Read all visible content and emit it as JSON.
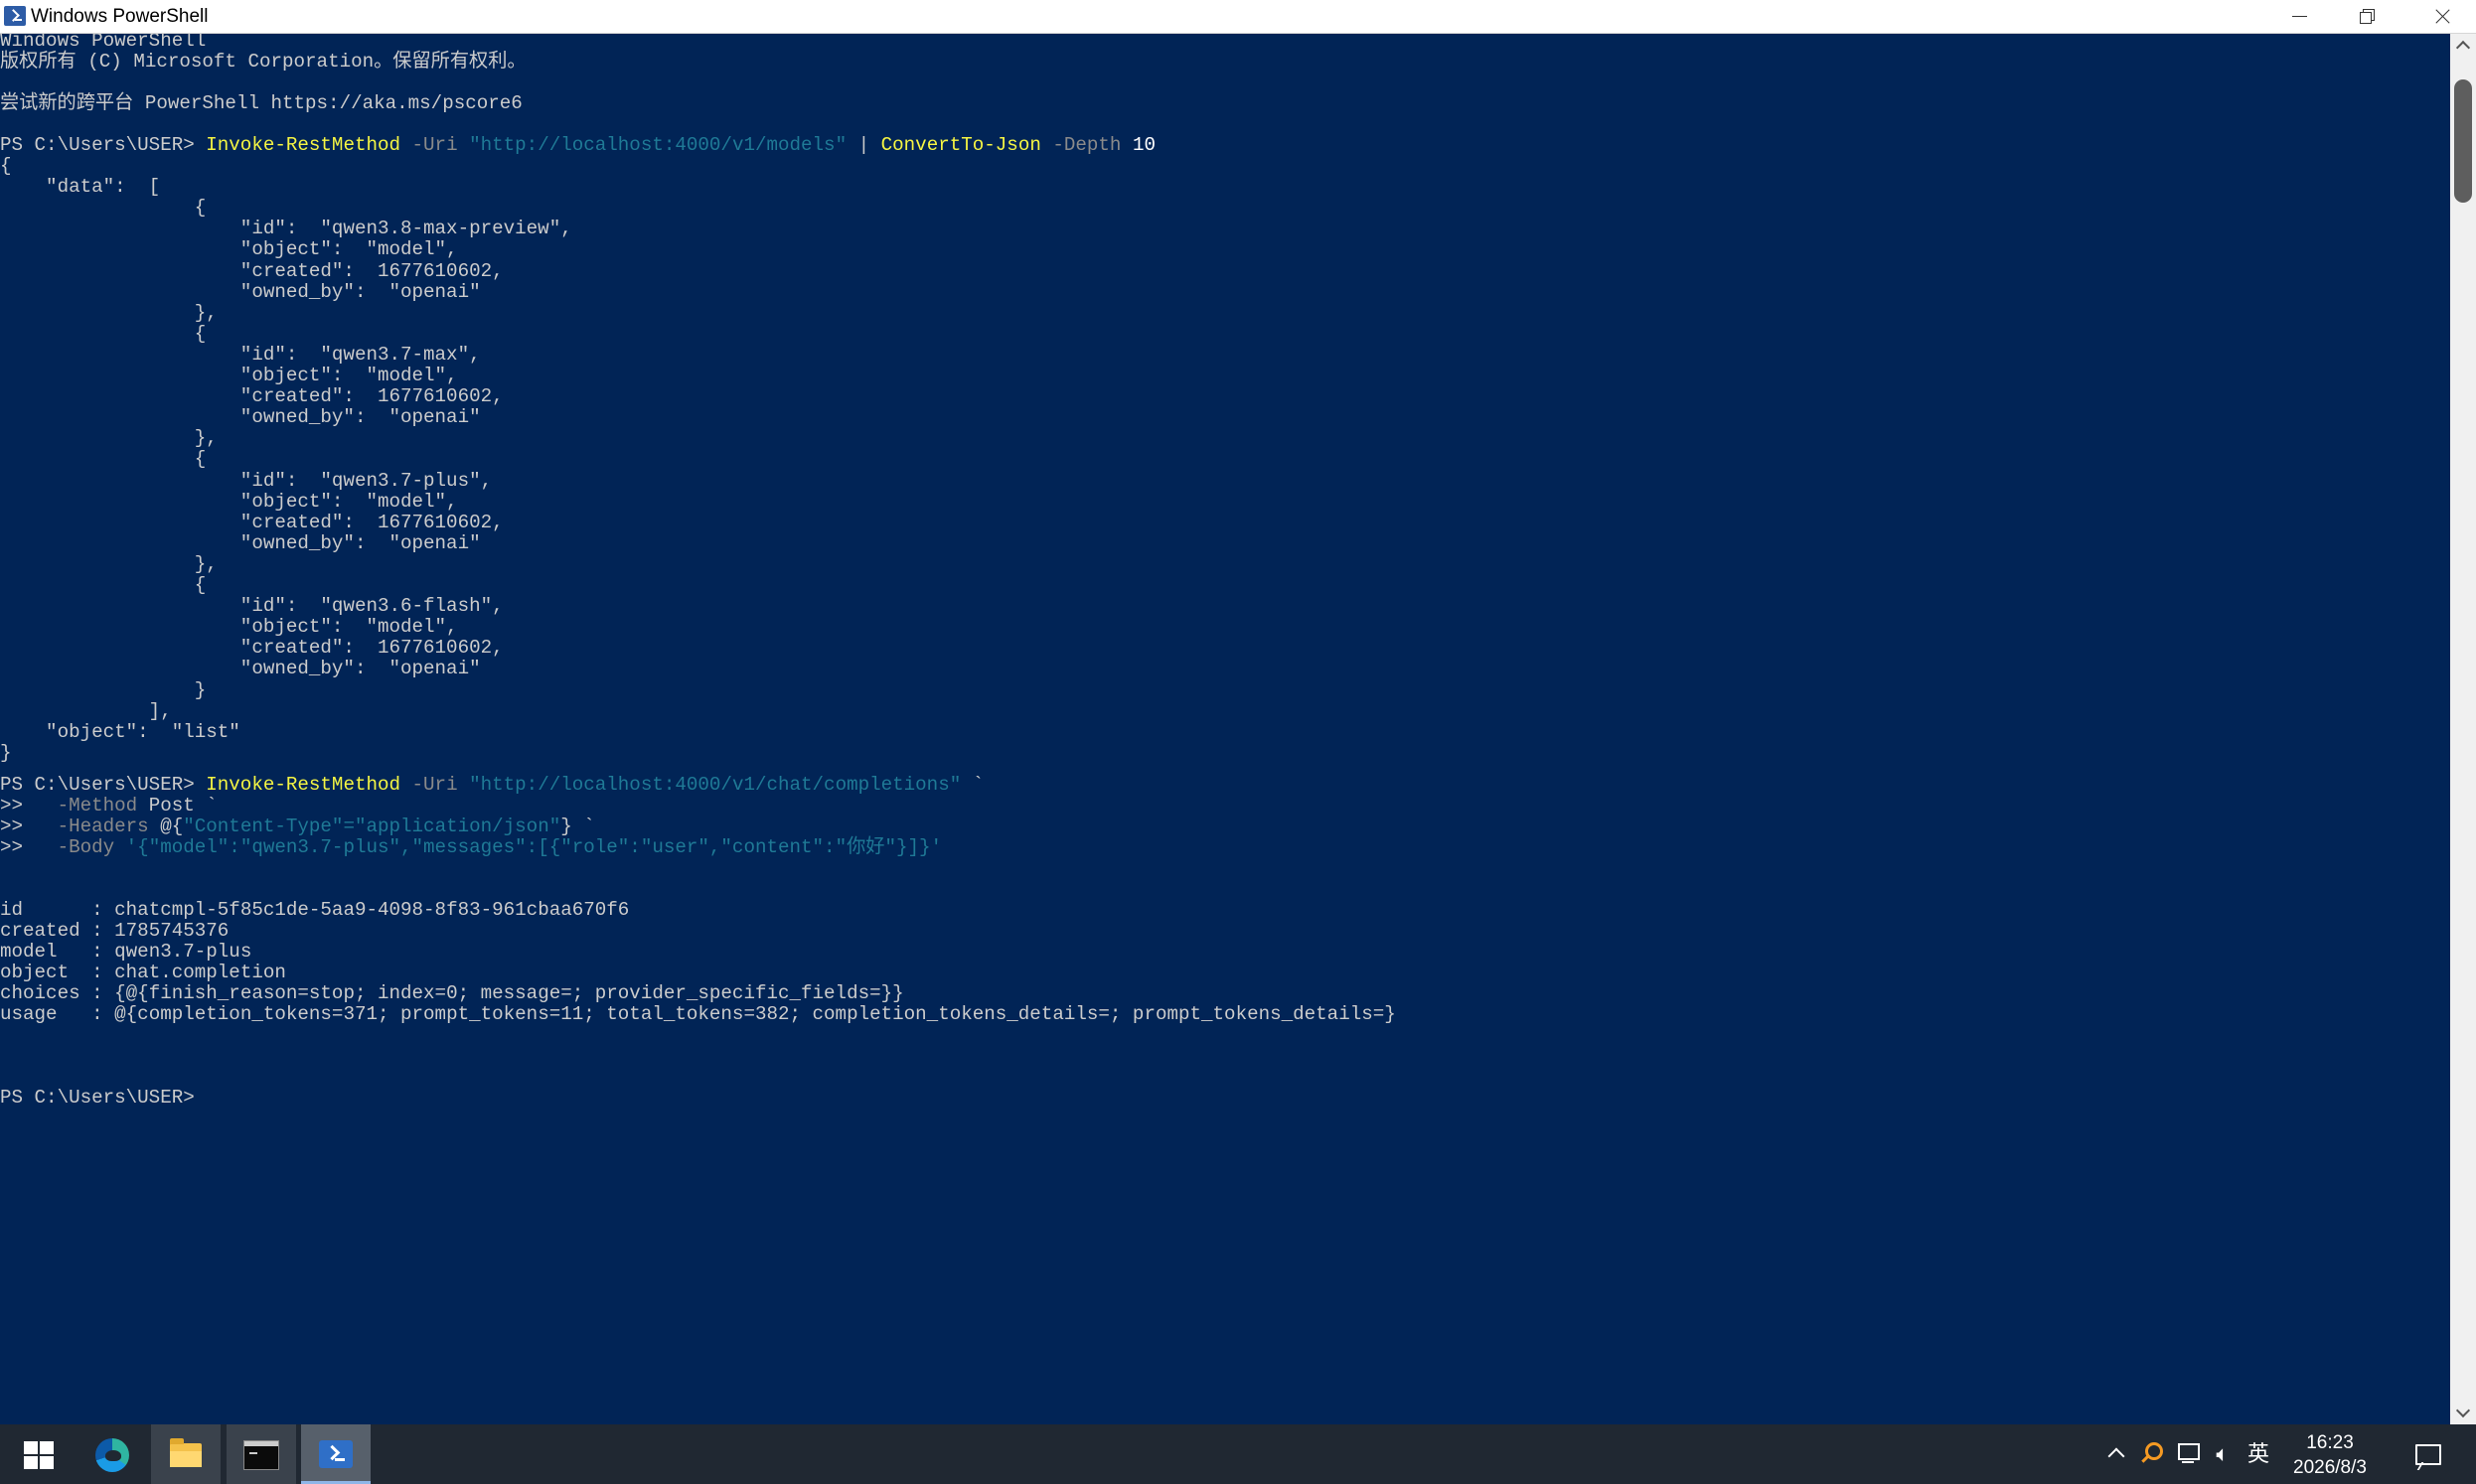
{
  "window": {
    "title": "Windows PowerShell"
  },
  "console": {
    "banner": {
      "line1": "Windows PowerShell",
      "line2": "版权所有 (C) Microsoft Corporation。保留所有权利。",
      "line3": "尝试新的跨平台 PowerShell https://aka.ms/pscore6"
    },
    "prompt": "PS C:\\Users\\USER>",
    "cmd1": {
      "cmdlet": "Invoke-RestMethod",
      "uri_param": "-Uri",
      "uri": "\"http://localhost:4000/v1/models\"",
      "pipe": "|",
      "cmdlet2": "ConvertTo-Json",
      "depth_param": "-Depth",
      "depth": "10"
    },
    "json_lines": [
      "{",
      "    \"data\":  [",
      "                 {",
      "                     \"id\":  \"qwen3.8-max-preview\",",
      "                     \"object\":  \"model\",",
      "                     \"created\":  1677610602,",
      "                     \"owned_by\":  \"openai\"",
      "                 },",
      "                 {",
      "                     \"id\":  \"qwen3.7-max\",",
      "                     \"object\":  \"model\",",
      "                     \"created\":  1677610602,",
      "                     \"owned_by\":  \"openai\"",
      "                 },",
      "                 {",
      "                     \"id\":  \"qwen3.7-plus\",",
      "                     \"object\":  \"model\",",
      "                     \"created\":  1677610602,",
      "                     \"owned_by\":  \"openai\"",
      "                 },",
      "                 {",
      "                     \"id\":  \"qwen3.6-flash\",",
      "                     \"object\":  \"model\",",
      "                     \"created\":  1677610602,",
      "                     \"owned_by\":  \"openai\"",
      "                 }",
      "             ],",
      "    \"object\":  \"list\"",
      "}"
    ],
    "cmd2": {
      "cmdlet": "Invoke-RestMethod",
      "uri_param": "-Uri",
      "uri": "\"http://localhost:4000/v1/chat/completions\"",
      "continuation": "`",
      "cont_prompt": ">>",
      "method_param": "-Method",
      "method_value": "Post",
      "headers_param": "-Headers",
      "headers_open": "@{",
      "headers_value": "\"Content-Type\"=\"application/json\"",
      "headers_close": "}",
      "body_param": "-Body",
      "body_value": "'{\"model\":\"qwen3.7-plus\",\"messages\":[{\"role\":\"user\",\"content\":\"你好\"}]}'"
    },
    "result": [
      {
        "key": "id     ",
        "value": "chatcmpl-5f85c1de-5aa9-4098-8f83-961cbaa670f6"
      },
      {
        "key": "created",
        "value": "1785745376"
      },
      {
        "key": "model  ",
        "value": "qwen3.7-plus"
      },
      {
        "key": "object ",
        "value": "chat.completion"
      },
      {
        "key": "choices",
        "value": "{@{finish_reason=stop; index=0; message=; provider_specific_fields=}}"
      },
      {
        "key": "usage  ",
        "value": "@{completion_tokens=371; prompt_tokens=11; total_tokens=382; completion_tokens_details=; prompt_tokens_details=}"
      }
    ],
    "separator": " : "
  },
  "taskbar": {
    "apps": [
      "start-icon",
      "edge-icon",
      "file-explorer-icon",
      "command-prompt-icon",
      "powershell-icon"
    ],
    "tray": {
      "ime": "英",
      "volume_glyph": "🔈︎"
    },
    "clock": {
      "time": "16:23",
      "date": "2026/8/3"
    }
  }
}
